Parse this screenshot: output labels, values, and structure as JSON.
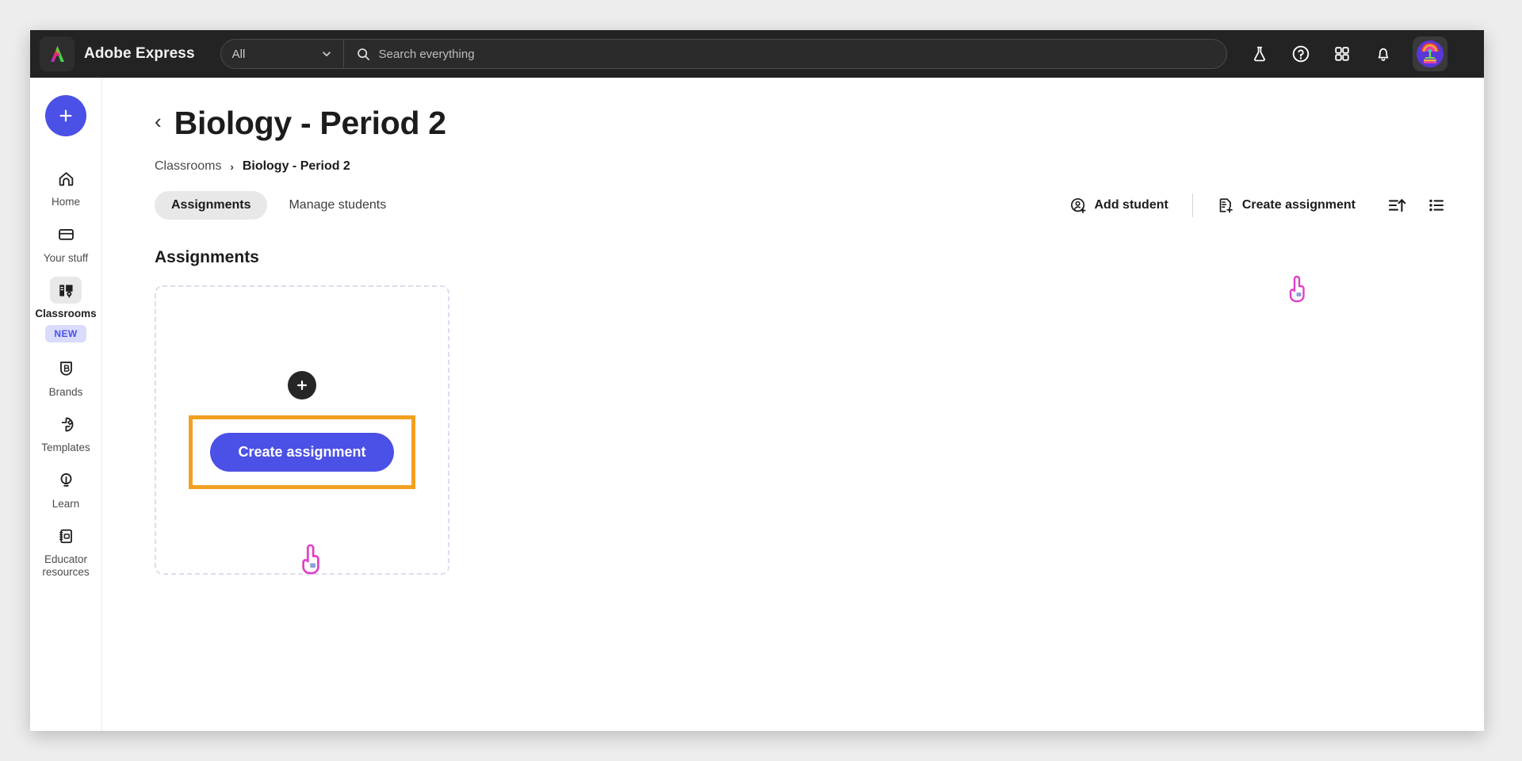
{
  "topnav": {
    "brand_label": "Adobe Express",
    "logo_icon": "adobe-express-logo",
    "scope_value": "All",
    "scope_chevron_icon": "chevron-down-icon",
    "search_icon": "search-icon",
    "search_value": "",
    "search_placeholder": "Search everything",
    "icons": [
      {
        "name": "beta-flask-icon",
        "glyph": "flask"
      },
      {
        "name": "help-icon",
        "glyph": "question-circle"
      },
      {
        "name": "apps-grid-icon",
        "glyph": "grid"
      },
      {
        "name": "notifications-bell-icon",
        "glyph": "bell"
      }
    ],
    "avatar_name": "user-avatar"
  },
  "sidebar": {
    "create_button_label": "+",
    "create_button_icon": "plus-icon",
    "items": [
      {
        "label": "Home",
        "icon": "home-icon",
        "active": false,
        "badge": null
      },
      {
        "label": "Your stuff",
        "icon": "folder-icon",
        "active": false,
        "badge": null
      },
      {
        "label": "Classrooms",
        "icon": "classrooms-icon",
        "active": true,
        "badge": "NEW"
      },
      {
        "label": "Brands",
        "icon": "brands-shield-icon",
        "active": false,
        "badge": null
      },
      {
        "label": "Templates",
        "icon": "templates-icon",
        "active": false,
        "badge": null
      },
      {
        "label": "Learn",
        "icon": "lightbulb-icon",
        "active": false,
        "badge": null
      },
      {
        "label": "Educator\nresources",
        "icon": "notebook-icon",
        "active": false,
        "badge": null
      }
    ]
  },
  "main": {
    "back_chevron_icon": "chevron-left-icon",
    "page_title": "Biology - Period 2",
    "breadcrumb": {
      "root": "Classrooms",
      "separator": "›",
      "current": "Biology - Period 2"
    },
    "tabs": [
      {
        "label": "Assignments",
        "selected": true
      },
      {
        "label": "Manage students",
        "selected": false
      }
    ],
    "actions": {
      "add_student_label": "Add student",
      "add_student_icon": "add-person-icon",
      "create_assignment_label": "Create assignment",
      "create_assignment_icon": "document-plus-icon",
      "sort_icon": "sort-ascending-icon",
      "view_icon": "list-view-icon"
    },
    "section_heading": "Assignments",
    "empty_state": {
      "plus_icon": "plus-icon",
      "cta_label": "Create assignment",
      "highlight_color": "#f2a021"
    }
  },
  "colors": {
    "brand_purple": "#4b50e6",
    "topnav_background": "#232323",
    "page_background": "#ffffff",
    "highlight_orange": "#f2a021",
    "badge_background": "#d9dcfc",
    "cursor_pink": "#e040c8"
  }
}
